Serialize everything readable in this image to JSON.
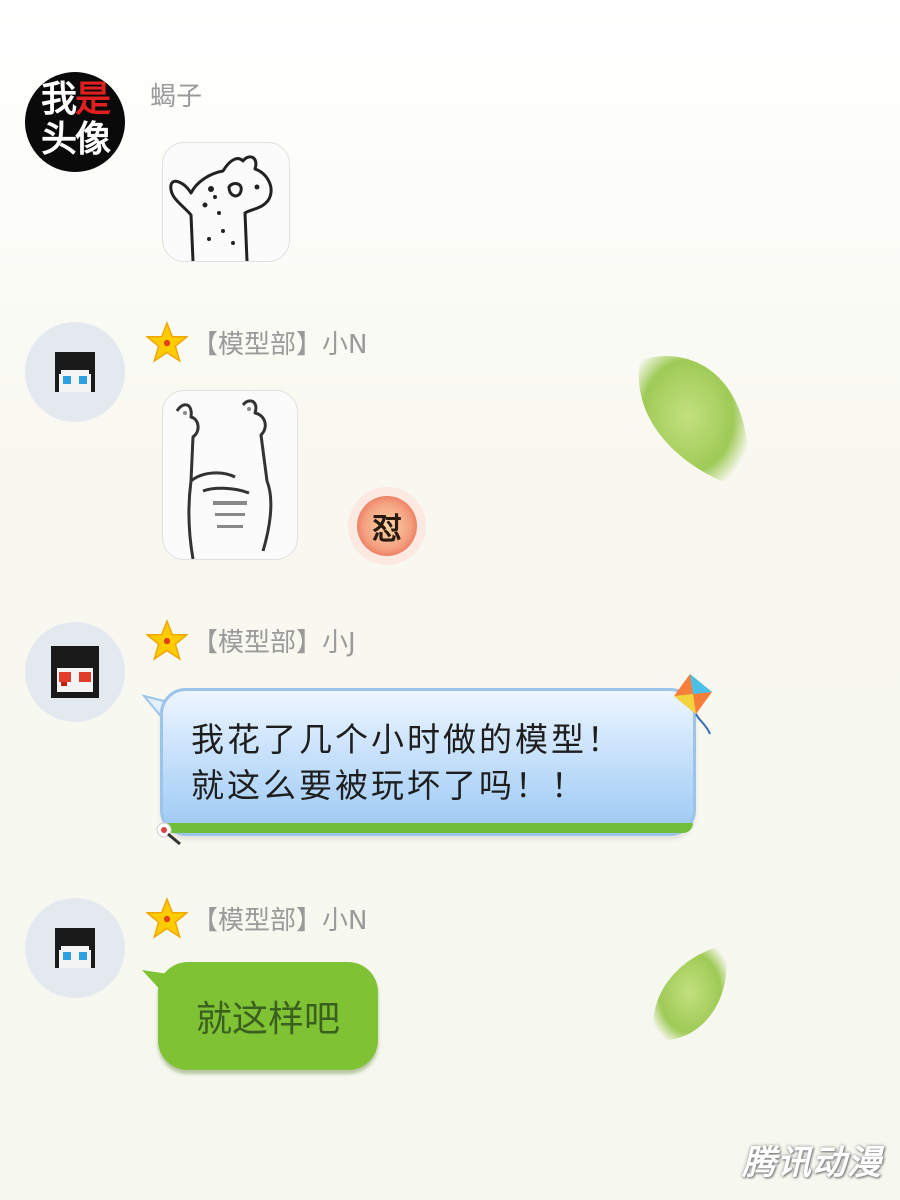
{
  "messages": [
    {
      "sender": "蝎子",
      "avatar_text_1": "我",
      "avatar_text_2": "是",
      "avatar_text_3": "头像",
      "type": "sticker",
      "sticker": "meme-raccoon-sticker"
    },
    {
      "sender": "【模型部】小N",
      "badge": "star-icon",
      "type": "sticker",
      "sticker": "thumbs-up-sticker",
      "reaction_text": "怼"
    },
    {
      "sender": "【模型部】小J",
      "badge": "star-icon",
      "type": "text",
      "text_line_1": "我花了几个小时做的模型！",
      "text_line_2": "就这么要被玩坏了吗！！"
    },
    {
      "sender": "【模型部】小N",
      "badge": "star-icon",
      "type": "text",
      "text": "就这样吧"
    }
  ],
  "watermark": "腾讯动漫",
  "colors": {
    "background": "#f8f8f0",
    "sender_text": "#9a9a9a",
    "blue_bubble": "#9cc9f4",
    "green_bubble": "#7fc234",
    "green_text": "#3a5f1e",
    "star": "#ffcc00"
  }
}
